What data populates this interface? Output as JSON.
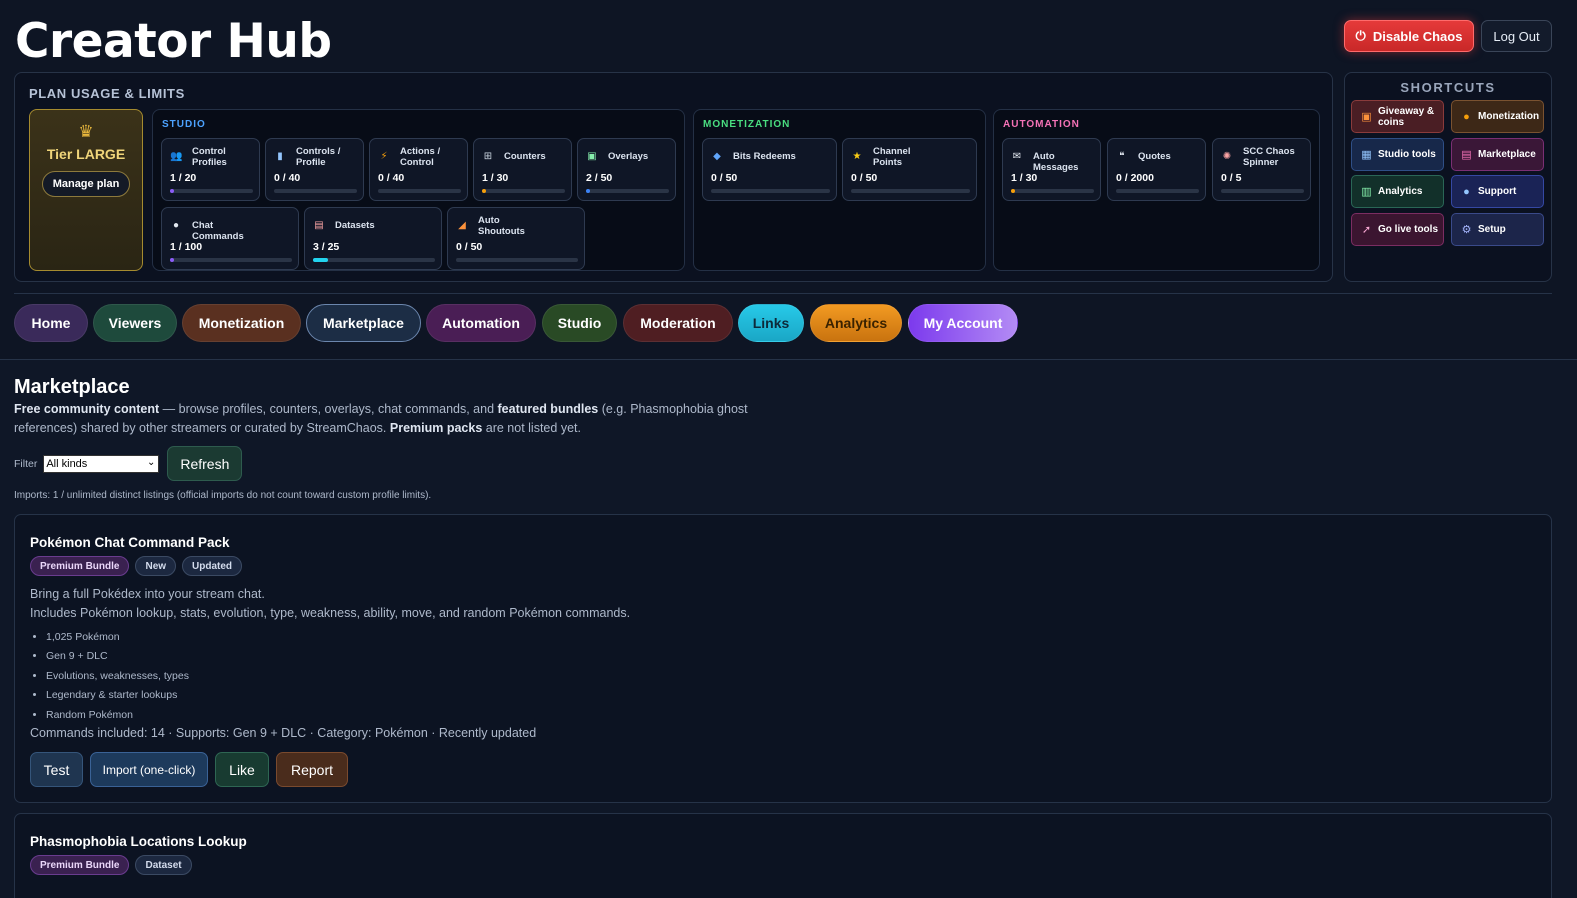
{
  "header": {
    "title": "Creator Hub",
    "disable_chaos": "Disable Chaos",
    "logout": "Log Out"
  },
  "plan": {
    "title": "PLAN USAGE & LIMITS",
    "tier": {
      "name": "Tier LARGE",
      "manage": "Manage plan"
    },
    "groups": [
      {
        "label": "STUDIO",
        "color": "#4da3ff",
        "cards": [
          {
            "name": "Control Profiles",
            "count": "1 / 20",
            "icon": "people-icon",
            "fill": 0.05,
            "color": "#8b5cf6"
          },
          {
            "name": "Controls / Profile",
            "count": "0 / 40",
            "icon": "phone-icon",
            "fill": 0,
            "color": "#8b5cf6"
          },
          {
            "name": "Actions / Control",
            "count": "0 / 40",
            "icon": "lightning-icon",
            "fill": 0,
            "color": "#8b5cf6"
          },
          {
            "name": "Counters",
            "count": "1 / 30",
            "icon": "grid-icon",
            "fill": 0.03,
            "color": "#f59e0b"
          },
          {
            "name": "Overlays",
            "count": "2 / 50",
            "icon": "image-icon",
            "fill": 0.04,
            "color": "#3b82f6"
          },
          {
            "name": "Chat Commands",
            "count": "1 / 100",
            "icon": "chat-icon",
            "fill": 0.01,
            "color": "#8b5cf6"
          },
          {
            "name": "Datasets",
            "count": "3 / 25",
            "icon": "books-icon",
            "fill": 0.12,
            "color": "#22d3ee"
          },
          {
            "name": "Auto Shoutouts",
            "count": "0 / 50",
            "icon": "megaphone-icon",
            "fill": 0,
            "color": "#8b5cf6"
          }
        ]
      },
      {
        "label": "MONETIZATION",
        "color": "#4ade80",
        "cards": [
          {
            "name": "Bits Redeems",
            "count": "0 / 50",
            "icon": "gem-icon",
            "fill": 0,
            "color": "#8b5cf6"
          },
          {
            "name": "Channel Points",
            "count": "0 / 50",
            "icon": "star-icon",
            "fill": 0,
            "color": "#8b5cf6"
          }
        ]
      },
      {
        "label": "AUTOMATION",
        "color": "#f472b6",
        "cards": [
          {
            "name": "Auto Messages",
            "count": "1 / 30",
            "icon": "envelope-icon",
            "fill": 0.03,
            "color": "#f59e0b"
          },
          {
            "name": "Quotes",
            "count": "0 / 2000",
            "icon": "quote-icon",
            "fill": 0,
            "color": "#8b5cf6"
          },
          {
            "name": "SCC Chaos Spinner",
            "count": "0 / 5",
            "icon": "spinner-icon",
            "fill": 0,
            "color": "#8b5cf6"
          }
        ]
      }
    ]
  },
  "shortcuts": {
    "title": "SHORTCUTS",
    "items": [
      {
        "label": "Giveaway & coins",
        "icon": "gift-icon",
        "color": "#4a1e24",
        "border": "#8a3b3b"
      },
      {
        "label": "Monetization",
        "icon": "money-bag-icon",
        "color": "#3d2817",
        "border": "#7a5230"
      },
      {
        "label": "Studio tools",
        "icon": "studio-icon",
        "color": "#17284a",
        "border": "#2f4f86"
      },
      {
        "label": "Marketplace",
        "icon": "store-icon",
        "color": "#3a1737",
        "border": "#7b2f74"
      },
      {
        "label": "Analytics",
        "icon": "chart-icon",
        "color": "#12302a",
        "border": "#2a6656"
      },
      {
        "label": "Support",
        "icon": "speech-icon",
        "color": "#1a2356",
        "border": "#3548a3"
      },
      {
        "label": "Go live tools",
        "icon": "rocket-icon",
        "color": "#3b1530",
        "border": "#7c2d62"
      },
      {
        "label": "Setup",
        "icon": "gear-icon",
        "color": "#1c254a",
        "border": "#3a4a8a"
      }
    ]
  },
  "nav": [
    {
      "label": "Home",
      "bg": "#3a2a5a"
    },
    {
      "label": "Viewers",
      "bg": "#1e4a3c"
    },
    {
      "label": "Monetization",
      "bg": "#5a3020"
    },
    {
      "label": "Marketplace",
      "bg": "#1c2d45"
    },
    {
      "label": "Automation",
      "bg": "#4a1e55"
    },
    {
      "label": "Studio",
      "bg": "#294a25"
    },
    {
      "label": "Moderation",
      "bg": "#4f1e22"
    },
    {
      "label": "Links",
      "bg": "#1fb8d8"
    },
    {
      "label": "Analytics",
      "bg": "#e08918"
    },
    {
      "label": "My Account",
      "bg": "#8a4ce8"
    }
  ],
  "main": {
    "title": "Marketplace",
    "desc_bold1": "Free community content",
    "desc_text1": " — browse profiles, counters, overlays, chat commands, and ",
    "desc_bold2": "featured bundles",
    "desc_text2": " (e.g. Phasmophobia ghost references) shared by other streamers or curated by StreamChaos. ",
    "desc_bold3": "Premium packs",
    "desc_text3": " are not listed yet.",
    "filter_label": "Filter",
    "filter_value": "All kinds",
    "refresh": "Refresh",
    "imports": "Imports: 1 / unlimited distinct listings (official imports do not count toward custom profile limits)."
  },
  "listings": [
    {
      "title": "Pokémon Chat Command Pack",
      "tags": [
        "Premium Bundle",
        "New",
        "Updated"
      ],
      "line1": "Bring a full Pokédex into your stream chat.",
      "line2": "Includes Pokémon lookup, stats, evolution, type, weakness, ability, move, and random Pokémon commands.",
      "bullets": [
        "1,025 Pokémon",
        "Gen 9 + DLC",
        "Evolutions, weaknesses, types",
        "Legendary & starter lookups",
        "Random Pokémon"
      ],
      "meta": "Commands included: 14 · Supports: Gen 9 + DLC · Category: Pokémon · Recently updated",
      "actions": [
        "Test",
        "Import (one-click)",
        "Like",
        "Report"
      ]
    },
    {
      "title": "Phasmophobia Locations Lookup",
      "tags": [
        "Premium Bundle",
        "Dataset"
      ]
    }
  ]
}
